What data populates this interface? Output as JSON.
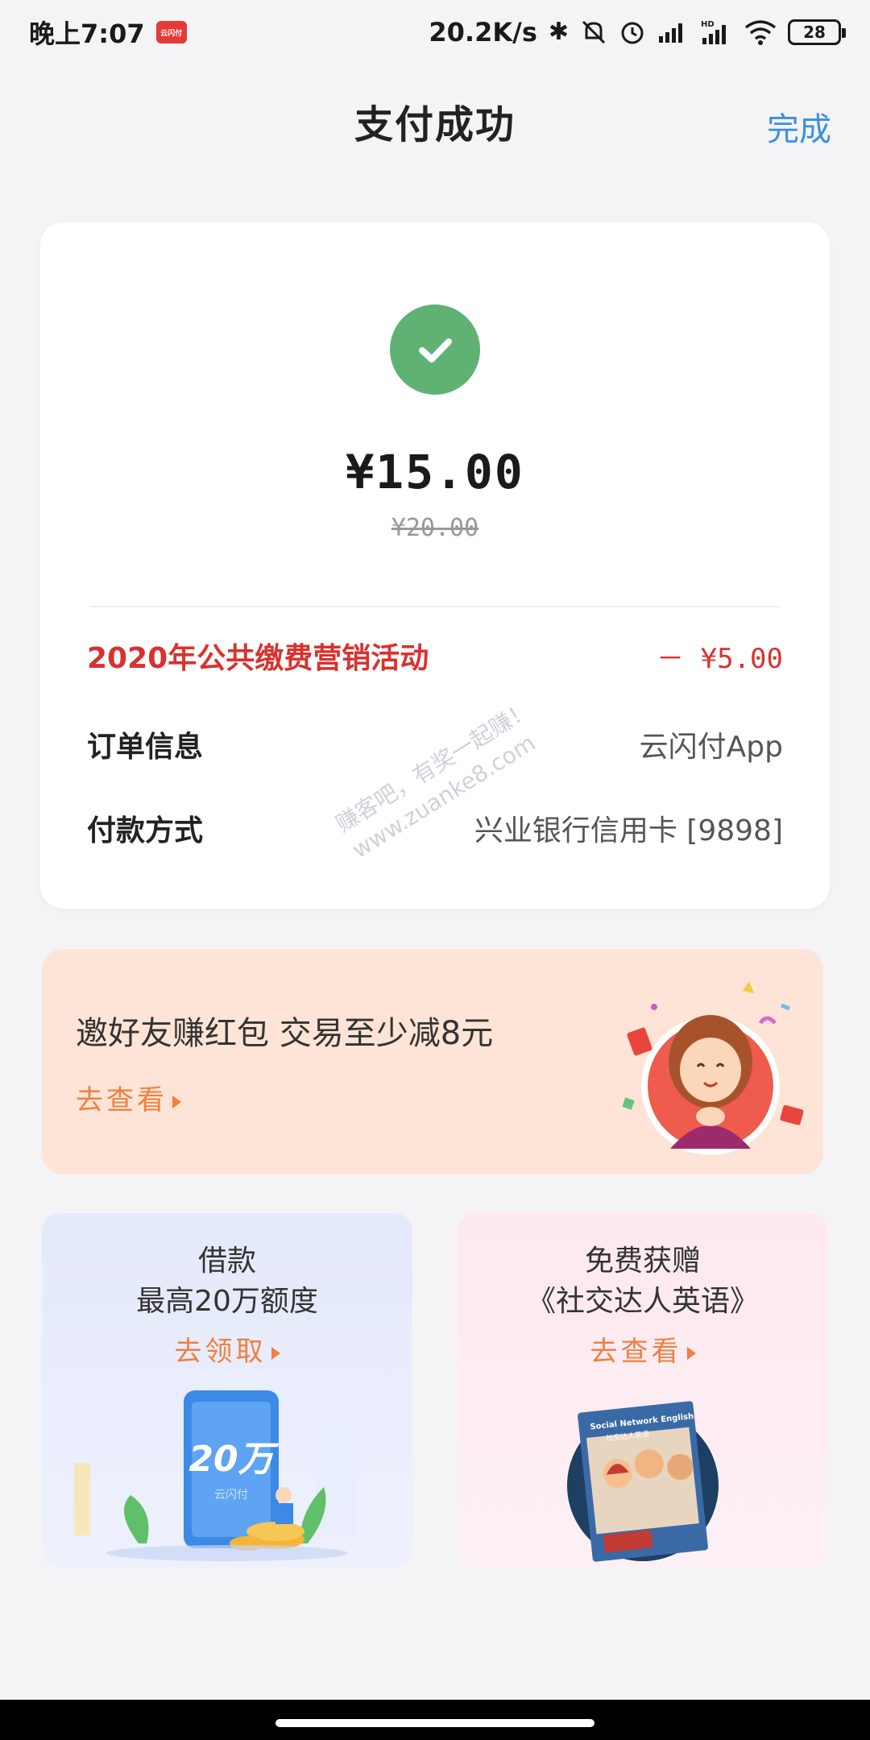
{
  "status_bar": {
    "time": "晚上7:07",
    "app_badge": "云闪付",
    "net_speed": "20.2K/s",
    "battery": "28"
  },
  "header": {
    "title": "支付成功",
    "done_label": "完成"
  },
  "payment": {
    "amount": "¥15.00",
    "original_amount": "¥20.00",
    "rows": [
      {
        "label": "2020年公共缴费营销活动",
        "value": "－ ¥5.00"
      },
      {
        "label": "订单信息",
        "value": "云闪付App"
      },
      {
        "label": "付款方式",
        "value": "兴业银行信用卡 [9898]"
      }
    ]
  },
  "watermark": {
    "line1": "赚客吧，有奖一起赚！",
    "line2": "www.zuanke8.com"
  },
  "invite_banner": {
    "title": "邀好友赚红包 交易至少减8元",
    "link": "去查看"
  },
  "loan_card": {
    "title_line1": "借款",
    "title_line2": "最高20万额度",
    "link": "去领取",
    "phone_text": "20万",
    "phone_brand": "云闪付"
  },
  "english_card": {
    "title_line1": "免费获赠",
    "title_line2": "《社交达人英语》",
    "link": "去查看",
    "book_title": "Social Network English",
    "book_subtitle": "社交达人英语"
  },
  "colors": {
    "accent_blue": "#3b8fe0",
    "success_green": "#5fb274",
    "promo_red": "#d8322f",
    "link_orange": "#ef8040"
  }
}
